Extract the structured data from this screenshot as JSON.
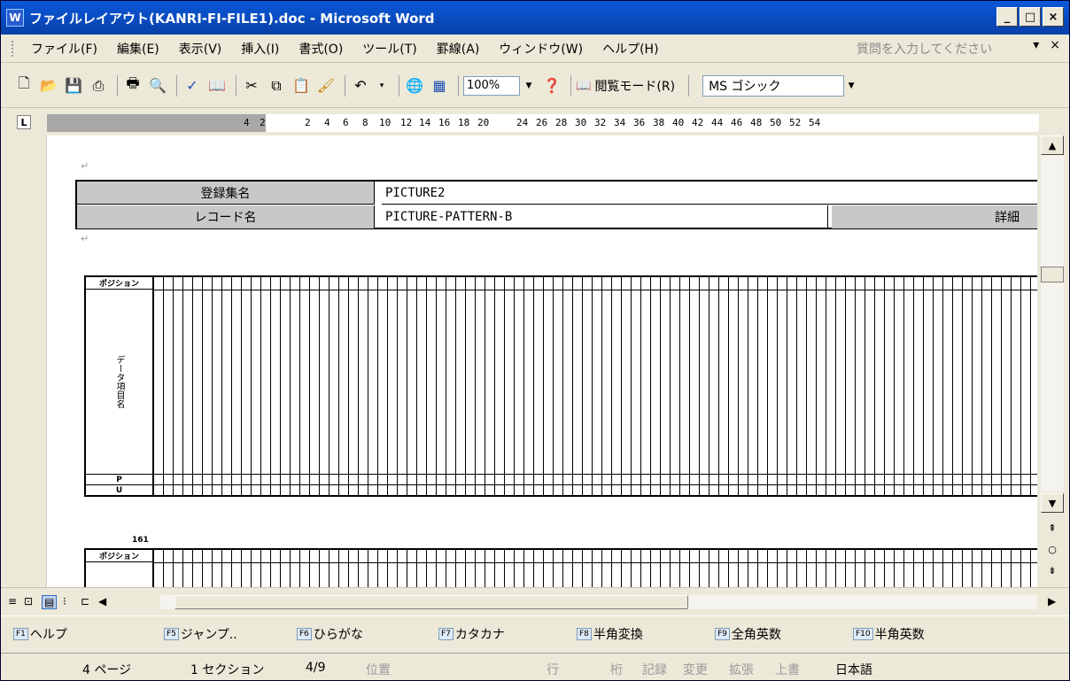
{
  "window": {
    "title": "ファイルレイアウト(KANRI-FI-FILE1).doc - Microsoft Word",
    "minimize": "_",
    "maximize": "□",
    "close": "×"
  },
  "menu": {
    "items": [
      "ファイル(F)",
      "編集(E)",
      "表示(V)",
      "挿入(I)",
      "書式(O)",
      "ツール(T)",
      "罫線(A)",
      "ウィンドウ(W)",
      "ヘルプ(H)"
    ],
    "help_placeholder": "質問を入力してください",
    "close_doc": "×"
  },
  "toolbar": {
    "zoom": "100%",
    "reading_mode": "閲覧モード(R)",
    "font": "MS ゴシック"
  },
  "ruler": {
    "ticks": [
      "4",
      "2",
      "2",
      "4",
      "6",
      "8",
      "10",
      "12",
      "14",
      "16",
      "18",
      "20",
      "24",
      "26",
      "28",
      "30",
      "32",
      "34",
      "36",
      "38",
      "40",
      "42",
      "44",
      "46",
      "48",
      "50",
      "52",
      "54"
    ]
  },
  "document": {
    "header_table": {
      "row1_label": "登録集名",
      "row1_value": "PICTURE2",
      "row2_label": "レコード名",
      "row2_value": "PICTURE-PATTERN-B",
      "detail_label": "詳細"
    },
    "grid1": {
      "position_label": "ポジション",
      "data_label": "データ項目名",
      "p_label": "P",
      "u_label": "U"
    },
    "grid2": {
      "marker": "161",
      "position_label": "ポジション"
    }
  },
  "fkeys": [
    {
      "key": "F1",
      "label": "ヘルプ"
    },
    {
      "key": "F5",
      "label": "ジャンプ.."
    },
    {
      "key": "F6",
      "label": "ひらがな"
    },
    {
      "key": "F7",
      "label": "カタカナ"
    },
    {
      "key": "F8",
      "label": "半角変換"
    },
    {
      "key": "F9",
      "label": "全角英数"
    },
    {
      "key": "F10",
      "label": "半角英数"
    }
  ],
  "status": {
    "page": "4 ページ",
    "section": "1 セクション",
    "pages": "4/9",
    "position": "位置",
    "line": "行",
    "column": "桁",
    "record": "記録",
    "track": "変更",
    "extend": "拡張",
    "overtype": "上書",
    "language": "日本語"
  }
}
